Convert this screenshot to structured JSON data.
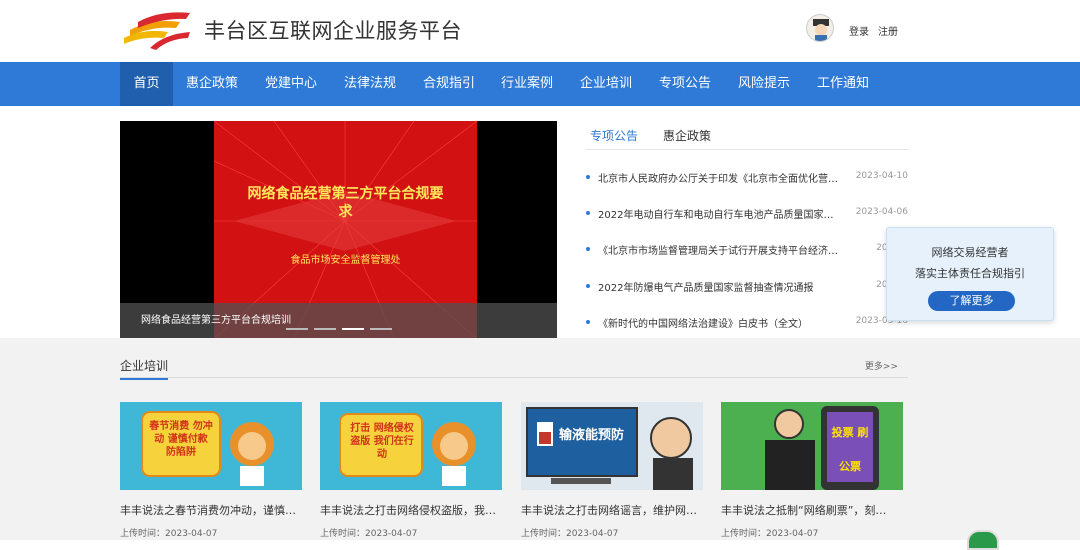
{
  "header": {
    "title": "丰台区互联网企业服务平台",
    "login": "登录",
    "register": "注册"
  },
  "nav": {
    "items": [
      "首页",
      "惠企政策",
      "党建中心",
      "法律法规",
      "合规指引",
      "行业案例",
      "企业培训",
      "专项公告",
      "风险提示",
      "工作通知"
    ],
    "active_index": 0
  },
  "banner": {
    "headline": "网络食品经营第三方平台合规要求",
    "subline": "食品市场安全监督管理处",
    "caption": "网络食品经营第三方平台合规培训",
    "active_dot": 2,
    "dot_count": 4
  },
  "news": {
    "tabs": [
      "专项公告",
      "惠企政策"
    ],
    "active_tab": 0,
    "items": [
      {
        "title": "北京市人民政府办公厅关于印发《北京市全面优化营商环境…",
        "date": "2023-04-10"
      },
      {
        "title": "2022年电动自行车和电动自行车电池产品质量国家监…",
        "date": "2023-04-06"
      },
      {
        "title": "《北京市市场监督管理局关于试行开展支持平台经济…",
        "date": "2023-0"
      },
      {
        "title": "2022年防爆电气产品质量国家监督抽查情况通报",
        "date": "2023-0"
      },
      {
        "title": "《新时代的中国网络法治建设》白皮书（全文）",
        "date": "2023-03-16"
      }
    ]
  },
  "popup": {
    "line1": "网络交易经营者",
    "line2": "落实主体责任合规指引",
    "button": "了解更多"
  },
  "training": {
    "title": "企业培训",
    "more": "更多>>",
    "date_prefix": "上传时间：",
    "cards": [
      {
        "title": "丰丰说法之春节消费勿冲动，谨慎…",
        "date": "2023-04-07",
        "image_text": "春节消费 勿冲动 谨慎付款 防陷阱",
        "bg": "#3fb8d8"
      },
      {
        "title": "丰丰说法之打击网络侵权盗版，我…",
        "date": "2023-04-07",
        "image_text": "打击 网络侵权盗版 我们在行动",
        "bg": "#3fb8d8"
      },
      {
        "title": "丰丰说法之打击网络谣言，维护网…",
        "date": "2023-04-07",
        "image_text": "输液能预防",
        "bg": "#2f8ed4"
      },
      {
        "title": "丰丰说法之抵制“网络刷票”，刻…",
        "date": "2023-04-07",
        "image_text": "投票 刷公票",
        "bg": "#4caf50"
      }
    ]
  },
  "colors": {
    "brand_blue": "#2e7ad6",
    "nav_active": "#1f5fae",
    "banner_red": "#d21212",
    "popup_button": "#2366c4"
  }
}
